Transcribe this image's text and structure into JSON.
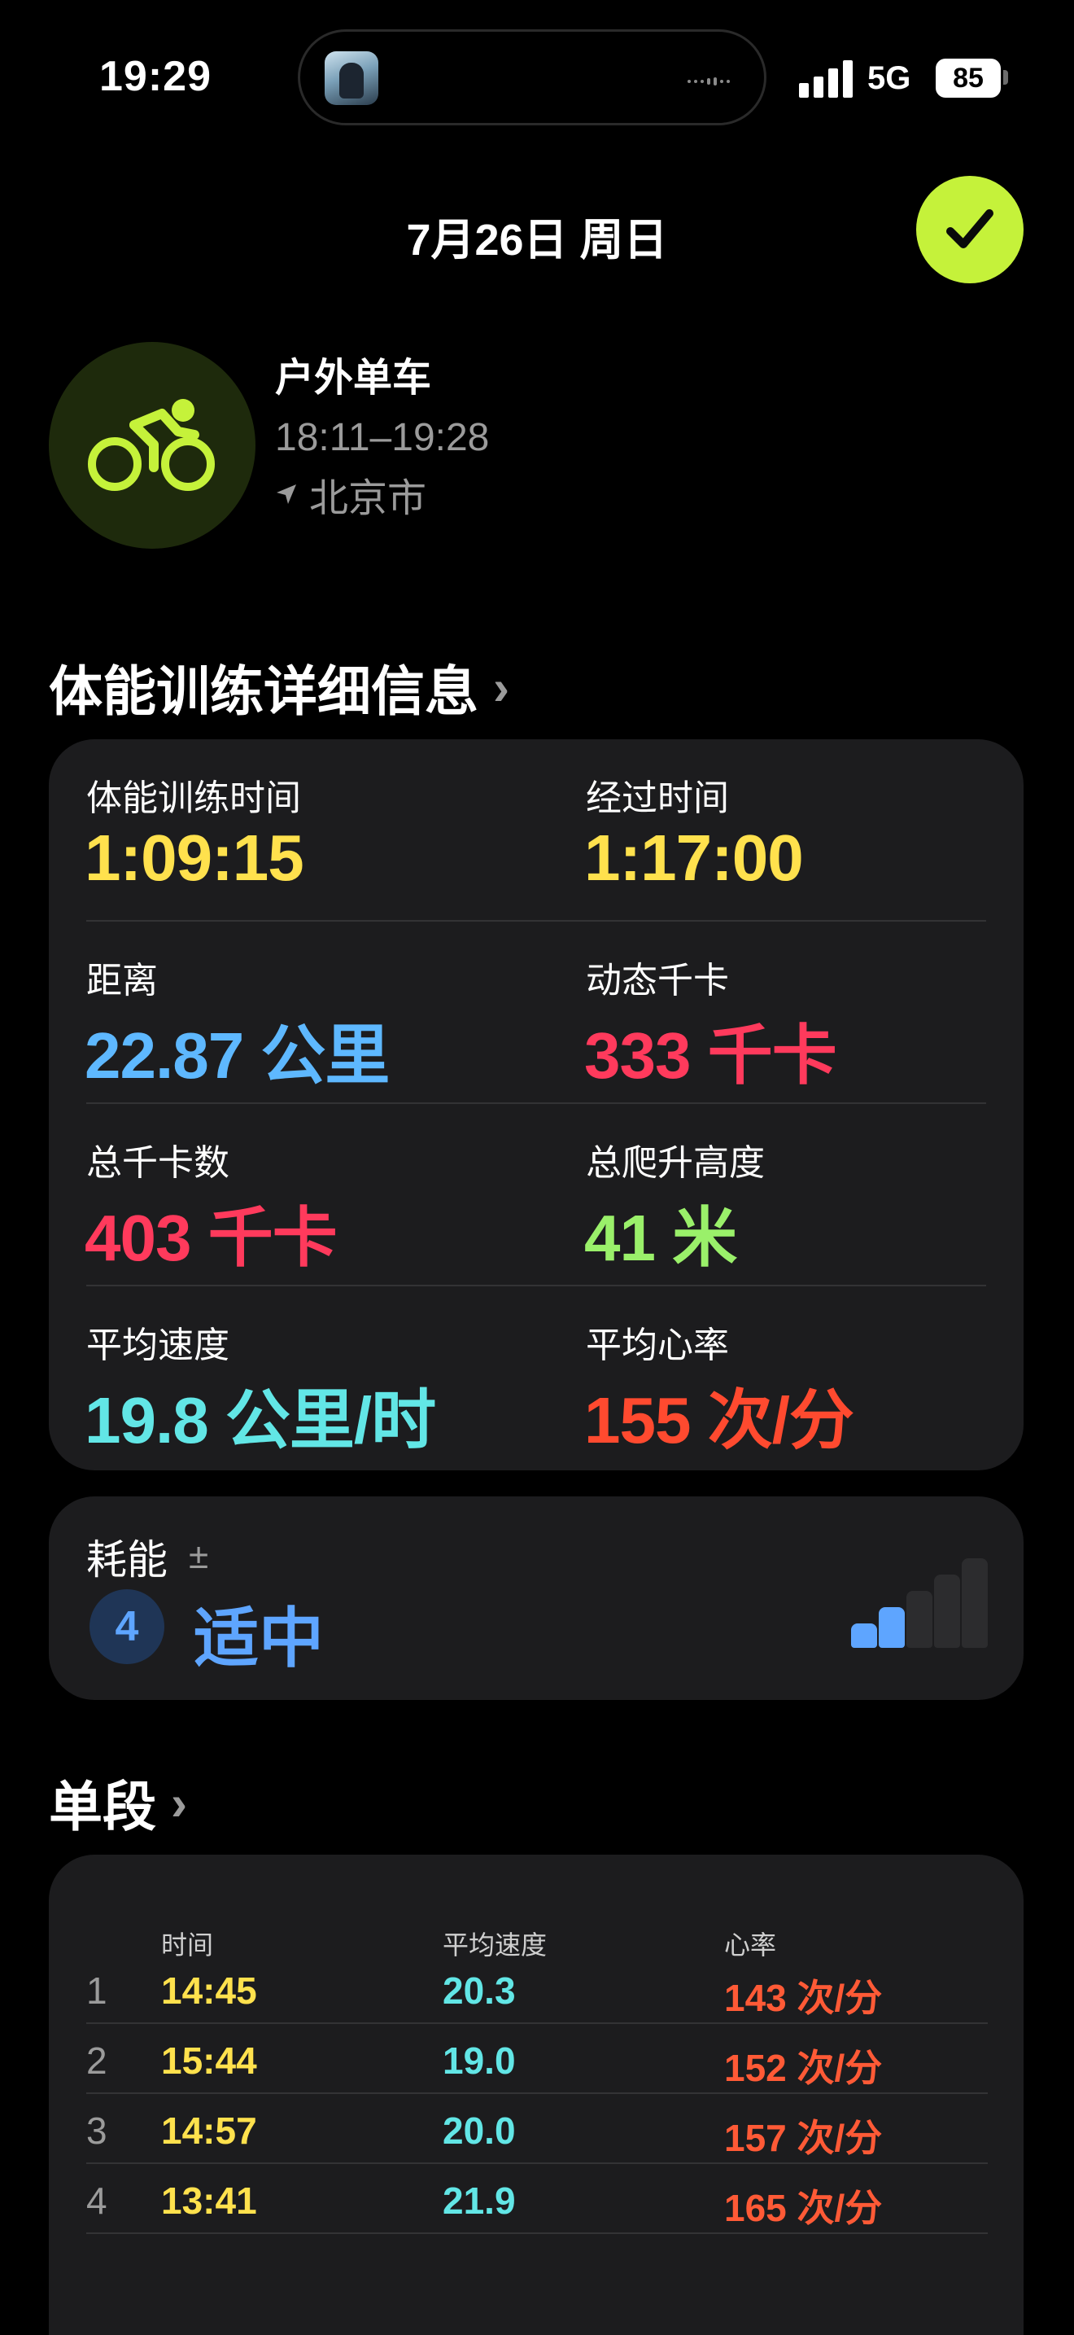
{
  "status_bar": {
    "time": "19:29",
    "network": "5G",
    "battery": "85",
    "signal_bars": 4
  },
  "header": {
    "date": "7月26日 周日",
    "done_icon": "checkmark-icon",
    "accent": "#c5f23a"
  },
  "workout": {
    "type": "户外单车",
    "time_range": "18:11–19:28",
    "location": "北京市",
    "icon": "cycling-icon"
  },
  "details_section": {
    "title": "体能训练详细信息",
    "metrics": [
      {
        "label": "体能训练时间",
        "value": "1:09:15",
        "color": "#ffe14d"
      },
      {
        "label": "经过时间",
        "value": "1:17:00",
        "color": "#ffe14d"
      },
      {
        "label": "距离",
        "value": "22.87 公里",
        "color": "#5eb8ff"
      },
      {
        "label": "动态千卡",
        "value": "333 千卡",
        "color": "#ff3a5c"
      },
      {
        "label": "总千卡数",
        "value": "403 千卡",
        "color": "#ff3a5c"
      },
      {
        "label": "总爬升高度",
        "value": "41 米",
        "color": "#9af06a"
      },
      {
        "label": "平均速度",
        "value": "19.8 公里/时",
        "color": "#62e6e6"
      },
      {
        "label": "平均心率",
        "value": "155 次/分",
        "color": "#ff4a2f"
      }
    ]
  },
  "effort": {
    "label": "耗能",
    "adjust_symbol": "±",
    "level": "4",
    "level_text": "适中",
    "level_fraction": 0.4,
    "color": "#5ea5ff"
  },
  "splits_section": {
    "title": "单段",
    "headers": [
      "时间",
      "平均速度",
      "心率"
    ],
    "rows": [
      {
        "index": "1",
        "time": "14:45",
        "speed": "20.3",
        "hr": "143 次/分"
      },
      {
        "index": "2",
        "time": "15:44",
        "speed": "19.0",
        "hr": "152 次/分"
      },
      {
        "index": "3",
        "time": "14:57",
        "speed": "20.0",
        "hr": "157 次/分"
      },
      {
        "index": "4",
        "time": "13:41",
        "speed": "21.9",
        "hr": "165 次/分"
      }
    ]
  }
}
